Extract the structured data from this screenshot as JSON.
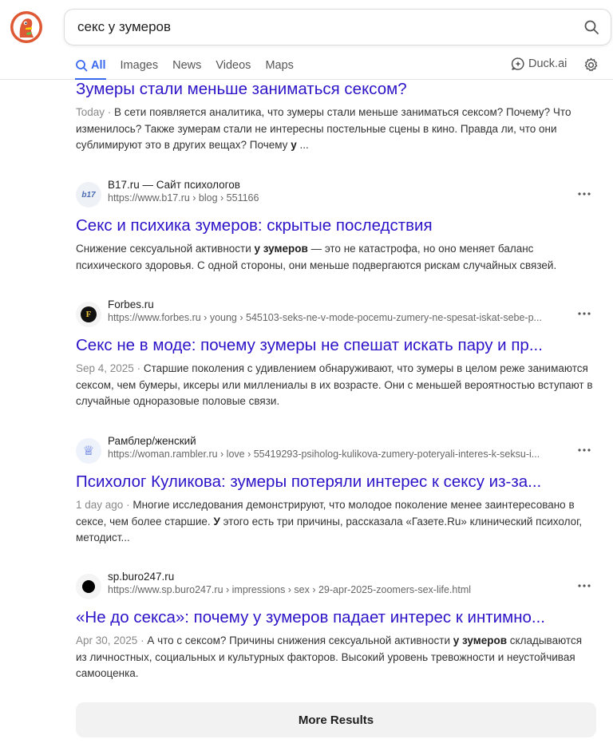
{
  "search": {
    "query": "секс у зумеров"
  },
  "tabs": [
    {
      "label": "All",
      "active": true
    },
    {
      "label": "Images"
    },
    {
      "label": "News"
    },
    {
      "label": "Videos"
    },
    {
      "label": "Maps"
    }
  ],
  "duckai_label": "Duck.ai",
  "colors": {
    "accent": "#3969ef",
    "link": "#2c14c8",
    "brand": "#de5833"
  },
  "results": [
    {
      "title": "Зумеры стали меньше заниматься сексом?",
      "date": "Today",
      "snippet_before": "В сети появляется аналитика, что зумеры стали меньше заниматься сексом? Почему? Что изменилось? Также зумерам стали не интересны постельные сцены в кино. Правда ли, что они сублимируют это в других вещах? Почему",
      "snippet_bold": "у",
      "snippet_after": "..."
    },
    {
      "site_name": "B17.ru — Сайт психологов",
      "url": "https://www.b17.ru › blog › 551166",
      "favicon_text": "b17",
      "title": "Секс и психика зумеров: скрытые последствия",
      "date": "",
      "snippet_before": "Снижение сексуальной активности",
      "snippet_bold": "у зумеров",
      "snippet_after": "— это не катастрофа, но оно меняет баланс психического здоровья. С одной стороны, они меньше подвергаются рискам случайных связей."
    },
    {
      "site_name": "Forbes.ru",
      "url": "https://www.forbes.ru › young › 545103-seks-ne-v-mode-pocemu-zumery-ne-spesat-iskat-sebe-p...",
      "favicon_text": "F",
      "title": "Секс не в моде: почему зумеры не спешат искать пару и пр...",
      "date": "Sep 4, 2025",
      "snippet_before": "Старшие поколения с удивлением обнаруживают, что зумеры в целом реже занимаются сексом, чем бумеры, иксеры или миллениалы в их возрасте. Они с меньшей вероятностью вступают в случайные одноразовые половые связи.",
      "snippet_bold": "",
      "snippet_after": ""
    },
    {
      "site_name": "Рамблер/женский",
      "url": "https://woman.rambler.ru › love › 55419293-psiholog-kulikova-zumery-poteryali-interes-k-seksu-i...",
      "favicon_text": "♕",
      "title": "Психолог Куликова: зумеры потеряли интерес к сексу из-за...",
      "date": "1 day ago",
      "snippet_before": "Многие исследования демонстрируют, что молодое поколение менее заинтересовано в сексе, чем более старшие.",
      "snippet_bold": "У",
      "snippet_after": "этого есть три причины, рассказала «Газете.Ru» клинический психолог, методист..."
    },
    {
      "site_name": "sp.buro247.ru",
      "url": "https://www.sp.buro247.ru › impressions › sex › 29-apr-2025-zoomers-sex-life.html",
      "favicon_text": "",
      "title": "«Не до секса»: почему у зумеров падает интерес к интимно...",
      "date": "Apr 30, 2025",
      "snippet_before": "А что с сексом? Причины снижения сексуальной активности",
      "snippet_bold": "у зумеров",
      "snippet_after": "складываются из личностных, социальных и культурных факторов. Высокий уровень тревожности и неустойчивая самооценка."
    }
  ],
  "more_results_label": "More Results"
}
